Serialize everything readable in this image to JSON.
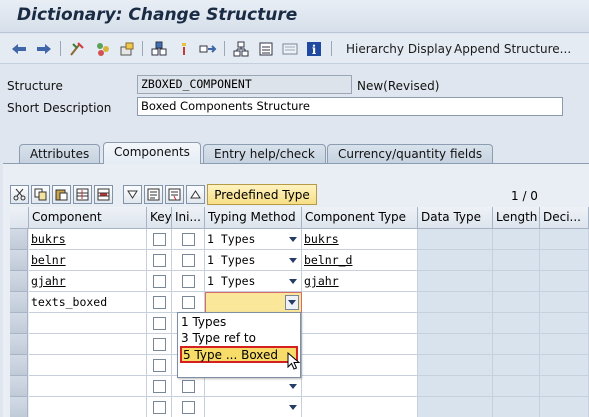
{
  "window": {
    "title": "Dictionary: Change Structure"
  },
  "toolbar": {
    "icons": [
      "back-arrow-icon",
      "forward-arrow-icon",
      "other-object-icon",
      "display-change-icon",
      "activate-icon",
      "where-used-icon",
      "object-list-icon",
      "navigation-window-icon",
      "hierarchy-icon",
      "list-icon",
      "display-object-list-icon",
      "info-icon"
    ],
    "hierarchy_display": "Hierarchy Display",
    "append_structure": "Append Structure..."
  },
  "header": {
    "structure_label": "Structure",
    "structure_value": "ZBOXED_COMPONENT",
    "status": "New(Revised)",
    "short_desc_label": "Short Description",
    "short_desc_value": "Boxed Components Structure"
  },
  "tabs": [
    {
      "label": "Attributes",
      "active": false
    },
    {
      "label": "Components",
      "active": true
    },
    {
      "label": "Entry help/check",
      "active": false
    },
    {
      "label": "Currency/quantity fields",
      "active": false
    }
  ],
  "table_toolbar": {
    "predefined_type": "Predefined Type",
    "counter": "1 / 0"
  },
  "table": {
    "columns": [
      "Component",
      "Key",
      "Ini...",
      "Typing Method",
      "Component Type",
      "Data Type",
      "Length",
      "Deci..."
    ],
    "rows": [
      {
        "component": "bukrs",
        "typing": "1 Types",
        "comp_type": "bukrs"
      },
      {
        "component": "belnr",
        "typing": "1 Types",
        "comp_type": "belnr_d"
      },
      {
        "component": "gjahr",
        "typing": "1 Types",
        "comp_type": "gjahr"
      },
      {
        "component": "texts_boxed",
        "typing": "",
        "comp_type": ""
      }
    ]
  },
  "dropdown": {
    "options": [
      "1 Types",
      "3 Type ref to",
      "5 Type ... Boxed"
    ],
    "highlighted": 2
  },
  "colors": {
    "highlight": "#f8dc6a",
    "selection_border": "#d42020",
    "background": "#dfe6ef"
  }
}
